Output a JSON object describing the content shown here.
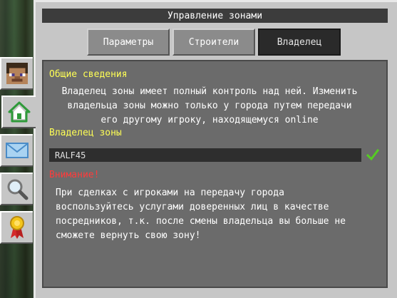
{
  "window": {
    "title": "Управление зонами"
  },
  "tabs": [
    {
      "label": "Параметры",
      "active": false
    },
    {
      "label": "Строители",
      "active": false
    },
    {
      "label": "Владелец",
      "active": true
    }
  ],
  "side_tabs": [
    {
      "icon": "player-head-icon",
      "active": false
    },
    {
      "icon": "home-icon",
      "active": true
    },
    {
      "icon": "mail-icon",
      "active": false
    },
    {
      "icon": "magnifier-icon",
      "active": false
    },
    {
      "icon": "award-ribbon-icon",
      "active": false
    }
  ],
  "general": {
    "heading": "Общие сведения",
    "lines": [
      "Владелец зоны имеет полный контроль над ней. Изменить",
      "владельца зоны можно только у города путем передачи",
      "его другому игроку, находящемуся online"
    ]
  },
  "owner": {
    "heading": "Владелец зоны",
    "value": "RALF45",
    "confirm_icon": "checkmark-icon"
  },
  "warning": {
    "heading": "Внимание!",
    "lines": [
      "При сделках с игроками на передачу города",
      "воспользуйтесь услугами доверенных лиц в качестве",
      "посредников, т.к. после смены владельца вы больше не",
      "сможете вернуть свою зону!"
    ]
  },
  "colors": {
    "heading_yellow": "#ffff55",
    "warning_red": "#ff3b3b",
    "confirm_green": "#55cc22"
  }
}
